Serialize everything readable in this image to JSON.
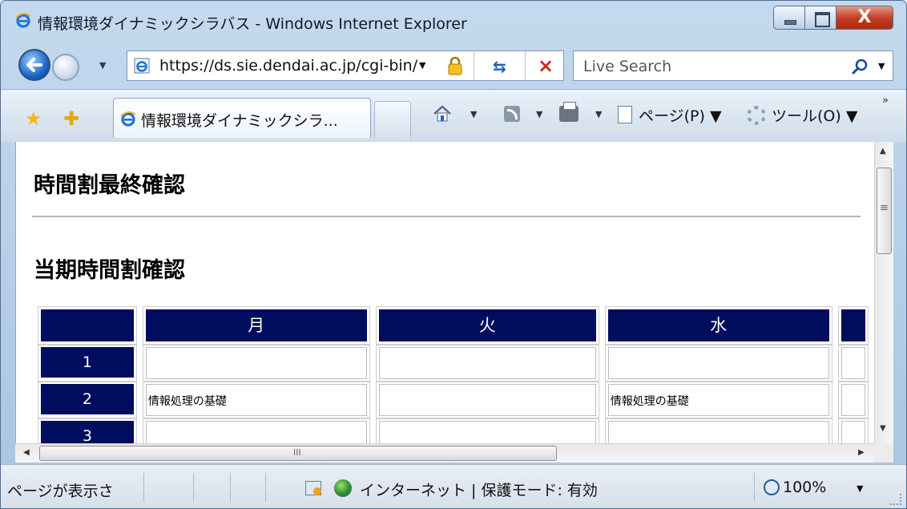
{
  "window": {
    "title": "情報環境ダイナミックシラバス - Windows Internet Explorer",
    "close_label": "X"
  },
  "address": {
    "url": "https://ds.sie.dendai.ac.jp/cgi-bin/",
    "dropdown": "▼"
  },
  "search": {
    "placeholder": "Live Search",
    "dropdown": "▼"
  },
  "tabs": {
    "active_label": "情報環境ダイナミックシラ..."
  },
  "commands": {
    "home_arrow": "▼",
    "feeds_arrow": "▼",
    "print_arrow": "▼",
    "page_label": "ページ(P) ▼",
    "tools_label": "ツール(O) ▼",
    "more": "»"
  },
  "page": {
    "heading_final": "時間割最終確認",
    "heading_current": "当期時間割確認"
  },
  "timetable": {
    "days": [
      "月",
      "火",
      "水"
    ],
    "periods": [
      "1",
      "2",
      "3"
    ],
    "cells": [
      [
        "",
        "",
        ""
      ],
      [
        "情報処理の基礎",
        "",
        "情報処理の基礎"
      ],
      [
        "",
        "",
        ""
      ]
    ]
  },
  "scroll": {
    "up": "▲",
    "down": "▼",
    "left": "◀",
    "right": "▶"
  },
  "status": {
    "text": "ページが表示さ",
    "zone": "インターネット | 保護モード: 有効",
    "zoom": "100%",
    "zoom_dropdown": "▼"
  },
  "colors": {
    "table_header": "#000d5e",
    "ie_blue": "#1d66c9",
    "close_red": "#c23a1e"
  },
  "icons": [
    "ie-icon",
    "lock-icon",
    "search-icon",
    "favorites-star-icon",
    "add-favorites-icon",
    "home-icon",
    "feeds-icon",
    "print-icon",
    "page-icon",
    "tools-icon",
    "popup-icon",
    "globe-icon",
    "zoom-icon"
  ]
}
